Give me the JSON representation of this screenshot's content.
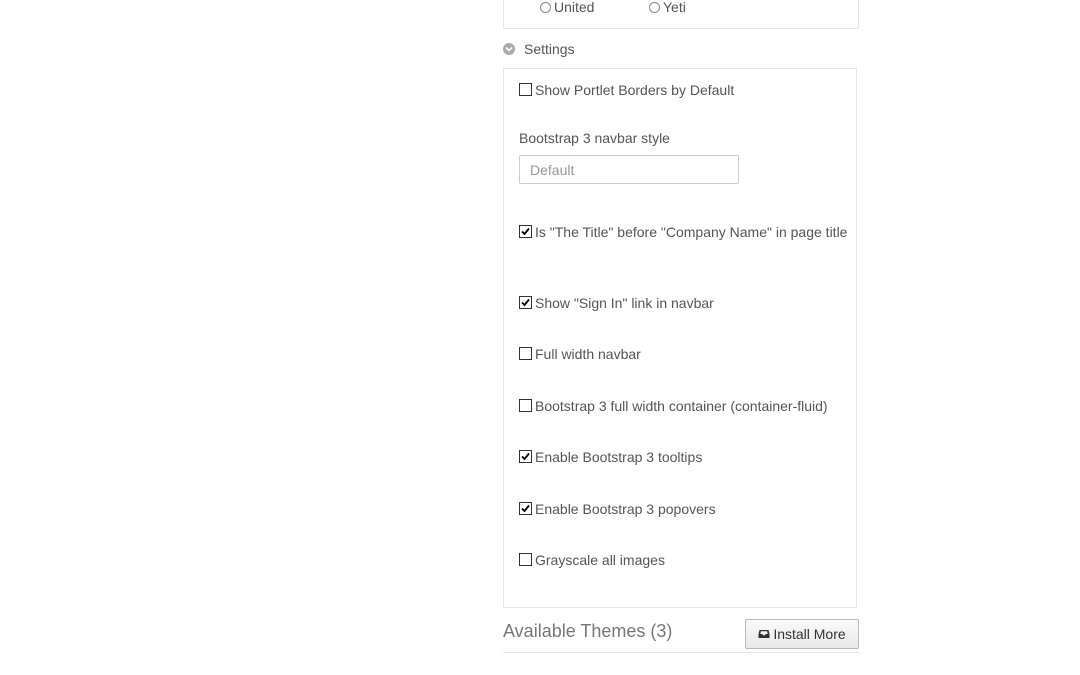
{
  "top_panel": {
    "radio_options": [
      {
        "label": "United",
        "checked": false
      },
      {
        "label": "Yeti",
        "checked": false
      }
    ]
  },
  "settings": {
    "title": "Settings",
    "icon": "chevron-circle-down-icon",
    "options": [
      {
        "label": "Show Portlet Borders by Default",
        "checked": false
      },
      {
        "label": "Is \"The Title\" before \"Company Name\" in page title",
        "checked": true
      },
      {
        "label": "Show \"Sign In\" link in navbar",
        "checked": true
      },
      {
        "label": "Full width navbar",
        "checked": false
      },
      {
        "label": "Bootstrap 3 full width container (container-fluid)",
        "checked": false
      },
      {
        "label": "Enable Bootstrap 3 tooltips",
        "checked": true
      },
      {
        "label": "Enable Bootstrap 3 popovers",
        "checked": true
      },
      {
        "label": "Grayscale all images",
        "checked": false
      }
    ],
    "navbar_style": {
      "label": "Bootstrap 3 navbar style",
      "placeholder": "Default",
      "value": ""
    }
  },
  "themes": {
    "title": "Available Themes (3)",
    "install_button": "Install More",
    "install_icon": "inbox-icon"
  }
}
